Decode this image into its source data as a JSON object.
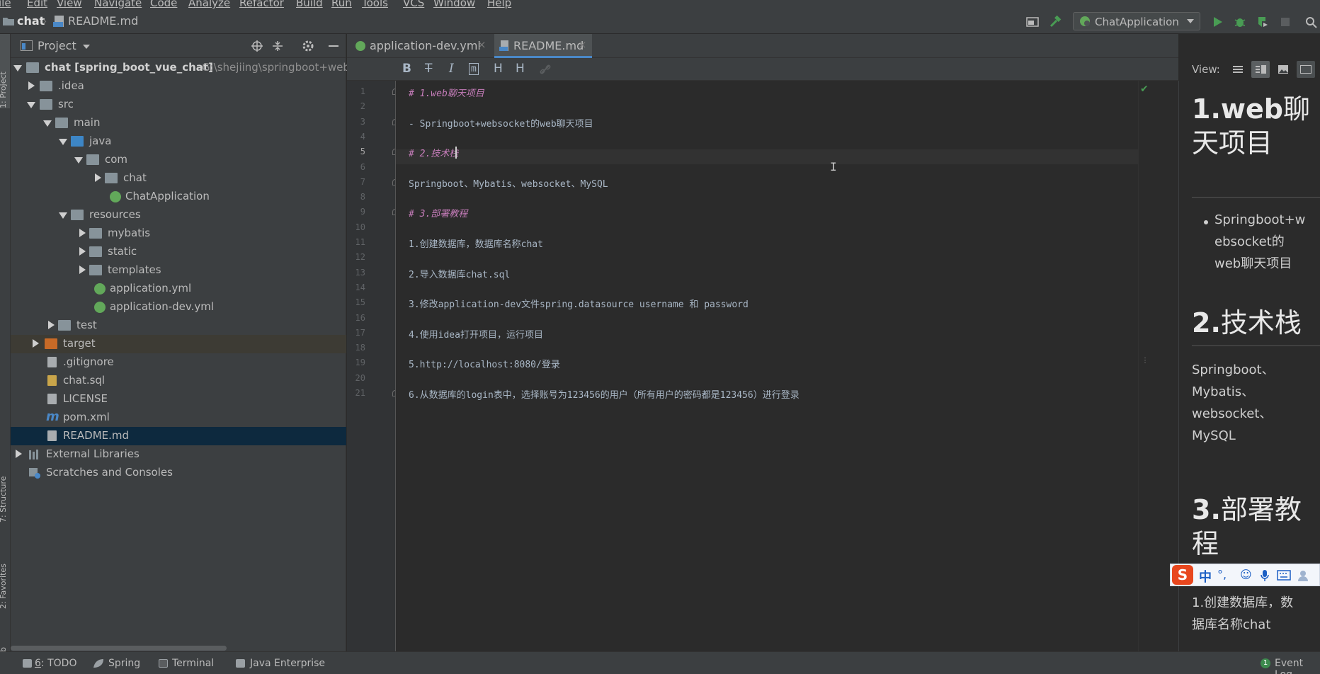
{
  "menu": [
    "ile",
    "Edit",
    "View",
    "Navigate",
    "Code",
    "Analyze",
    "Refactor",
    "Build",
    "Run",
    "Tools",
    "VCS",
    "Window",
    "Help"
  ],
  "breadcrumb": {
    "project": "chat",
    "file": "README.md"
  },
  "run_config": "ChatApplication",
  "left_strip": [
    "1: Project",
    "7: Structure",
    "2: Favorites",
    "Web"
  ],
  "project_panel": {
    "title": "Project",
    "root": {
      "name": "chat [spring_boot_vue_chat]",
      "path": "G:\\shejiing\\springboot+web"
    },
    "items": [
      {
        "label": ".idea"
      },
      {
        "label": "src"
      },
      {
        "label": "main"
      },
      {
        "label": "java"
      },
      {
        "label": "com"
      },
      {
        "label": "chat"
      },
      {
        "label": "ChatApplication"
      },
      {
        "label": "resources"
      },
      {
        "label": "mybatis"
      },
      {
        "label": "static"
      },
      {
        "label": "templates"
      },
      {
        "label": "application.yml"
      },
      {
        "label": "application-dev.yml"
      },
      {
        "label": "test"
      },
      {
        "label": "target"
      },
      {
        "label": ".gitignore"
      },
      {
        "label": "chat.sql"
      },
      {
        "label": "LICENSE"
      },
      {
        "label": "pom.xml"
      },
      {
        "label": "README.md"
      },
      {
        "label": "External Libraries"
      },
      {
        "label": "Scratches and Consoles"
      }
    ]
  },
  "tabs": [
    {
      "label": "application-dev.yml",
      "active": false
    },
    {
      "label": "README.md",
      "active": true
    }
  ],
  "md_toolbar": {
    "bold": "B",
    "strike": "T",
    "italic": "I",
    "code": "m",
    "h_dec": "H",
    "h_inc": "H",
    "view_label": "View:"
  },
  "editor": {
    "current_line": 5,
    "lines": [
      "# 1.web聊天项目",
      "",
      "- Springboot+websocket的web聊天项目",
      "",
      "# 2.技术栈",
      "",
      "Springboot、Mybatis、websocket、MySQL",
      "",
      "# 3.部署教程",
      "",
      "1.创建数据库，数据库名称chat",
      "",
      "2.导入数据库chat.sql",
      "",
      "3.修改application-dev文件spring.datasource username 和 password",
      "",
      "4.使用idea打开项目，运行项目",
      "",
      "5.http://localhost:8080/登录",
      "",
      "6.从数据库的login表中，选择账号为123456的用户（所有用户的密码都是123456）进行登录"
    ]
  },
  "preview": {
    "h1_a_num": "1.web",
    "h1_a_rest": "聊",
    "h1_a_line2": "天项目",
    "li_1": "Springboot+w",
    "li_2": "ebsocket的",
    "li_3": "web聊天项目",
    "h1_b_num": "2.",
    "h1_b_rest": "技术栈",
    "p_1": "Springboot、",
    "p_2": "Mybatis、",
    "p_3": "websocket、",
    "p_4": "MySQL",
    "h1_c_num": "3.",
    "h1_c_rest": "部署教",
    "h1_c_line2": "程",
    "p_5": "1.创建数据库，数",
    "p_6": "据库名称chat"
  },
  "ime": {
    "logo": "S",
    "mode": "中",
    "punct": "°,"
  },
  "statusbar": {
    "todo_num": "6",
    "todo": ": TODO",
    "spring": "Spring",
    "terminal": "Terminal",
    "java_ee": "Java Enterprise",
    "event_count": "1",
    "event_log": "Event Log"
  },
  "colors": {
    "selection": "#0d293e",
    "accent": "#4a88c7",
    "heading": "#c77dbb"
  }
}
